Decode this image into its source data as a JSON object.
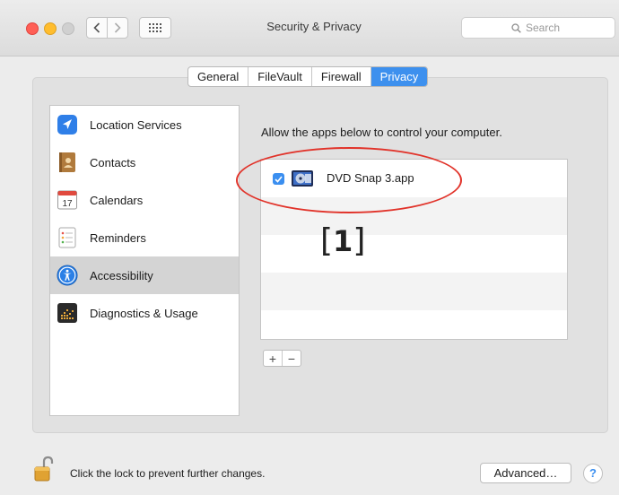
{
  "window": {
    "title": "Security & Privacy",
    "search_placeholder": "Search"
  },
  "tabs": [
    {
      "label": "General",
      "active": false
    },
    {
      "label": "FileVault",
      "active": false
    },
    {
      "label": "Firewall",
      "active": false
    },
    {
      "label": "Privacy",
      "active": true
    }
  ],
  "sidebar": {
    "items": [
      {
        "label": "Location Services",
        "icon": "location-arrow-icon",
        "selected": false
      },
      {
        "label": "Contacts",
        "icon": "contacts-book-icon",
        "selected": false
      },
      {
        "label": "Calendars",
        "icon": "calendar-icon",
        "selected": false
      },
      {
        "label": "Reminders",
        "icon": "reminders-list-icon",
        "selected": false
      },
      {
        "label": "Accessibility",
        "icon": "accessibility-icon",
        "selected": true
      },
      {
        "label": "Diagnostics & Usage",
        "icon": "diagnostics-icon",
        "selected": false
      }
    ]
  },
  "calendar_icon_day": "17",
  "main": {
    "description": "Allow the apps below to control your computer.",
    "apps": [
      {
        "name": "DVD Snap 3.app",
        "checked": true,
        "icon": "dvd-snap-app-icon"
      }
    ],
    "annotation_open": "[",
    "annotation_number": "1",
    "annotation_close": "]",
    "add_label": "+",
    "remove_label": "−"
  },
  "footer": {
    "lock_text": "Click the lock to prevent further changes.",
    "advanced_label": "Advanced…",
    "help_label": "?"
  },
  "colors": {
    "accent": "#3d90ee",
    "annotation": "#e1332a",
    "selected_row": "#d4d4d4"
  }
}
